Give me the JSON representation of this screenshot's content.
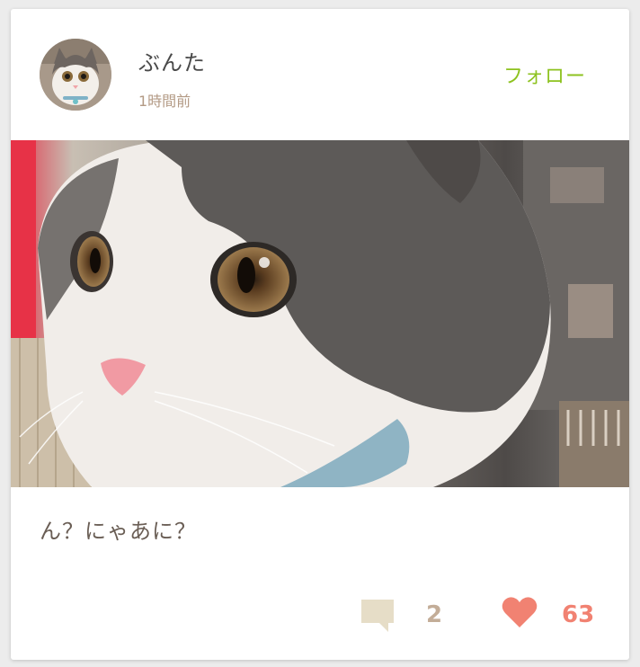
{
  "post": {
    "user": {
      "name": "ぶんた",
      "time": "1時間前",
      "avatar_icon": "cat-avatar"
    },
    "follow_label": "フォロー",
    "photo_icon": "cat-photo",
    "caption": "ん？にゃあに？",
    "comments": {
      "icon": "comment-icon",
      "count": "2"
    },
    "likes": {
      "icon": "heart-icon",
      "count": "63"
    }
  },
  "colors": {
    "accent_green": "#8dc21f",
    "muted_brown": "#c3ad98",
    "heart_coral": "#f18272",
    "comment_icon": "#e6ddc7"
  }
}
